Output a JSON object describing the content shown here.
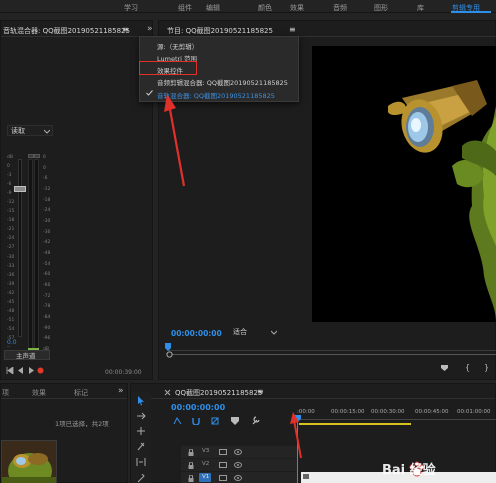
{
  "workspace_tabs": [
    "学习",
    "组件",
    "编辑",
    "颜色",
    "效果",
    "音频",
    "图形",
    "库",
    "剪辑专用"
  ],
  "active_workspace": "剪辑专用",
  "more_label": "»",
  "audio_mixer": {
    "tab_label": "音轨混合器: QQ截图20190521185825",
    "menu_glyph": "≡",
    "read_mode": "读取",
    "meter_scale": [
      "dB",
      "0",
      "-3",
      "-6",
      "-9",
      "-12",
      "-15",
      "-18",
      "-21",
      "-24",
      "-27",
      "-30",
      "-33",
      "-36",
      "-39",
      "-42",
      "-45",
      "-48",
      "-51",
      "-54",
      "-57",
      "--"
    ],
    "right_scale": [
      "6",
      "0",
      "-6",
      "-12",
      "-18",
      "-24",
      "-30",
      "-36",
      "-42",
      "-48",
      "-54",
      "-60",
      "-66",
      "-72",
      "-78",
      "-84",
      "-90",
      "-96",
      "dB"
    ],
    "fader_value": "0.0",
    "master_label": "主声道",
    "timecode": "00:00:39:00"
  },
  "program_monitor": {
    "tab_label": "节目: QQ截图20190521185825",
    "menu_glyph": "≡",
    "timecode": "00:00:00:00",
    "fit_label": "适合"
  },
  "panel_menu": {
    "items": [
      {
        "label": "源:（无剪辑）",
        "checked": false,
        "highlight": false
      },
      {
        "label": "Lumetri 范围",
        "checked": false,
        "highlight": false
      },
      {
        "label": "效果控件",
        "checked": false,
        "highlight": true
      },
      {
        "label": "音频剪辑混合器: QQ截图20190521185825",
        "checked": false,
        "highlight": false
      },
      {
        "label": "音轨混合器: QQ截图20190521185825",
        "checked": true,
        "highlight": false,
        "blue": true
      }
    ]
  },
  "project_panel": {
    "tabs": [
      "项",
      "效果",
      "标记"
    ],
    "more_label": "»",
    "selection_text": "1项已选择，共2项"
  },
  "timeline": {
    "tab_label": "QQ截图20190521185825",
    "menu_glyph": "≡",
    "timecode": "00:00:00:00",
    "ruler": [
      ":00:00",
      "00:00:15:00",
      "00:00:30:00",
      "00:00:45:00",
      "00:01:00:00"
    ],
    "tracks": [
      "V3",
      "V2",
      "V1"
    ]
  },
  "watermark": "Bai 经验",
  "colors": {
    "accent": "#2f8fe8",
    "annotation": "#e0302a"
  }
}
